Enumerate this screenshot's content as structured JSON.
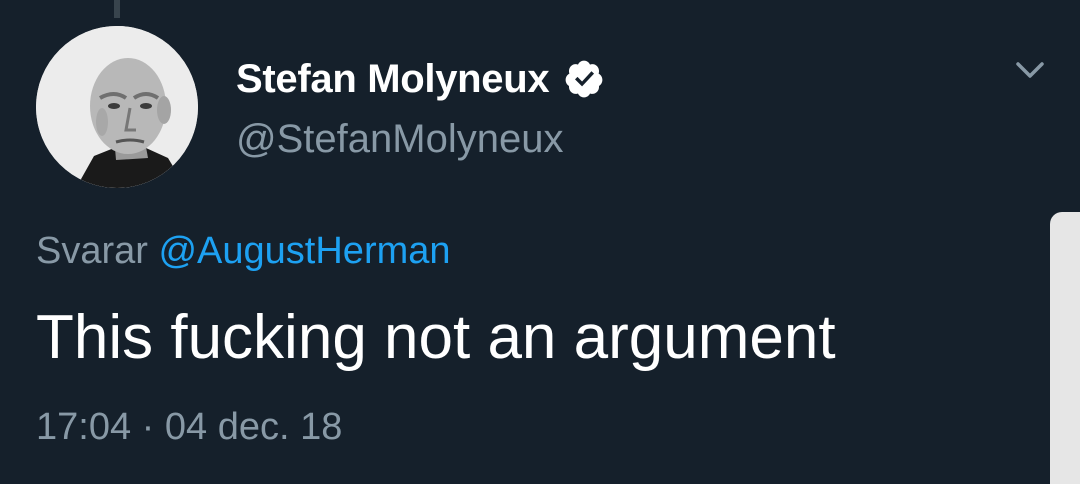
{
  "tweet": {
    "author": {
      "display_name": "Stefan Molyneux",
      "handle": "@StefanMolyneux",
      "verified": true
    },
    "reply": {
      "prefix": "Svarar",
      "mention": "@AugustHerman"
    },
    "text": "This fucking not an argument",
    "timestamp": {
      "time": "17:04",
      "separator": "·",
      "date": "04 dec. 18"
    }
  },
  "colors": {
    "background": "#15202b",
    "primary_text": "#ffffff",
    "secondary_text": "#8899a6",
    "link": "#1da1f2"
  },
  "icons": {
    "verified": "verified-badge-icon",
    "menu": "chevron-down-icon"
  }
}
